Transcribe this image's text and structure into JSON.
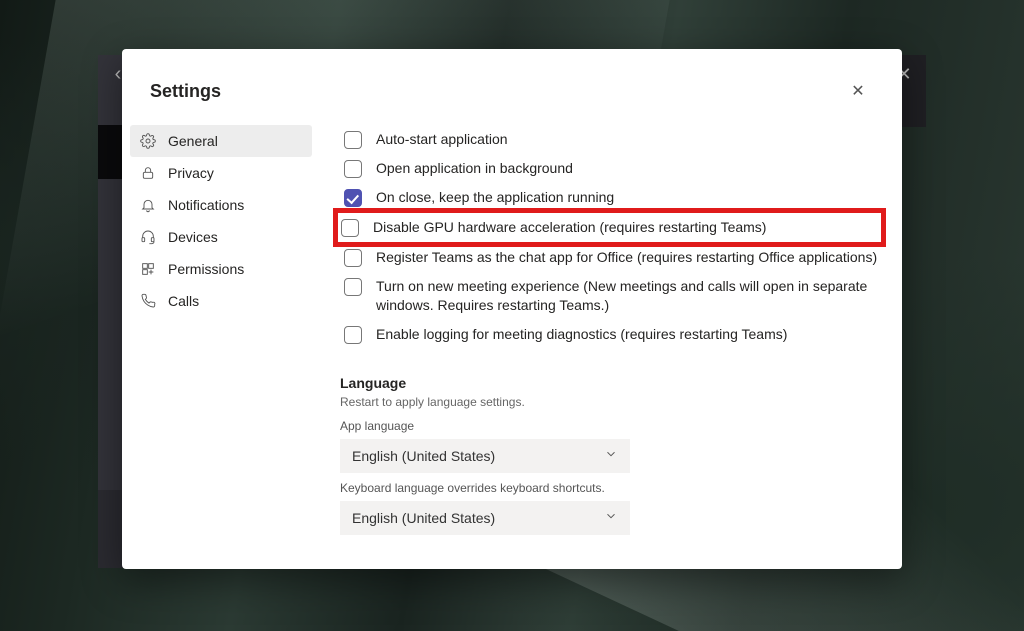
{
  "modal": {
    "title": "Settings"
  },
  "sidebar": {
    "items": [
      {
        "label": "General",
        "icon": "gear-icon",
        "active": true
      },
      {
        "label": "Privacy",
        "icon": "lock-icon",
        "active": false
      },
      {
        "label": "Notifications",
        "icon": "bell-icon",
        "active": false
      },
      {
        "label": "Devices",
        "icon": "headset-icon",
        "active": false
      },
      {
        "label": "Permissions",
        "icon": "app-icon",
        "active": false
      },
      {
        "label": "Calls",
        "icon": "phone-icon",
        "active": false
      }
    ]
  },
  "options": [
    {
      "label": "Auto-start application",
      "checked": false,
      "highlight": false
    },
    {
      "label": "Open application in background",
      "checked": false,
      "highlight": false
    },
    {
      "label": "On close, keep the application running",
      "checked": true,
      "highlight": false
    },
    {
      "label": "Disable GPU hardware acceleration (requires restarting Teams)",
      "checked": false,
      "highlight": true
    },
    {
      "label": "Register Teams as the chat app for Office (requires restarting Office applications)",
      "checked": false,
      "highlight": false
    },
    {
      "label": "Turn on new meeting experience (New meetings and calls will open in separate windows. Requires restarting Teams.)",
      "checked": false,
      "highlight": false
    },
    {
      "label": "Enable logging for meeting diagnostics (requires restarting Teams)",
      "checked": false,
      "highlight": false
    }
  ],
  "language": {
    "heading": "Language",
    "sub": "Restart to apply language settings.",
    "app_label": "App language",
    "app_value": "English (United States)",
    "kbd_label": "Keyboard language overrides keyboard shortcuts.",
    "kbd_value": "English (United States)"
  },
  "colors": {
    "accent": "#4f52b2",
    "highlight": "#e01b1b"
  }
}
